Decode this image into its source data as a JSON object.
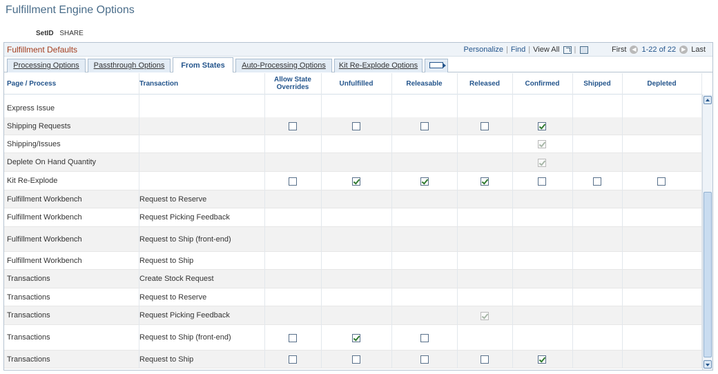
{
  "page": {
    "title": "Fulfillment Engine Options"
  },
  "setid": {
    "label": "SetID",
    "value": "SHARE"
  },
  "grid": {
    "title": "Fulfillment Defaults",
    "nav": {
      "personalize": "Personalize",
      "find": "Find",
      "view_all": "View All",
      "first": "First",
      "range": "1-22 of 22",
      "last": "Last",
      "icons": [
        "zoom-icon",
        "download-icon",
        "prev-icon",
        "next-icon"
      ]
    }
  },
  "tabs": [
    {
      "label": "Processing Options",
      "active": false
    },
    {
      "label": "Passthrough Options",
      "active": false
    },
    {
      "label": "From States",
      "active": true
    },
    {
      "label": "Auto-Processing Options",
      "active": false
    },
    {
      "label": "Kit Re-Explode Options",
      "active": false
    },
    {
      "label": "",
      "icon": "show-all-columns-icon"
    }
  ],
  "columns": {
    "page_process": "Page / Process",
    "transaction": "Transaction",
    "allow": "Allow State Overrides",
    "unfulfilled": "Unfulfilled",
    "releasable": "Releasable",
    "released": "Released",
    "confirmed": "Confirmed",
    "shipped": "Shipped",
    "depleted": "Depleted"
  },
  "rows": [
    {
      "page": "Express Issue",
      "transaction": ""
    },
    {
      "page": "Shipping Requests",
      "transaction": ""
    },
    {
      "page": "Shipping/Issues",
      "transaction": ""
    },
    {
      "page": "Deplete On Hand Quantity",
      "transaction": ""
    },
    {
      "page": "Kit Re-Explode",
      "transaction": ""
    },
    {
      "page": "Fulfillment Workbench",
      "transaction": "Request to Reserve"
    },
    {
      "page": "Fulfillment Workbench",
      "transaction": "Request Picking Feedback"
    },
    {
      "page": "Fulfillment Workbench",
      "transaction": "Request to Ship (front-end)"
    },
    {
      "page": "Fulfillment Workbench",
      "transaction": "Request to Ship"
    },
    {
      "page": "Transactions",
      "transaction": "Create Stock Request"
    },
    {
      "page": "Transactions",
      "transaction": "Request to Reserve"
    },
    {
      "page": "Transactions",
      "transaction": "Request Picking Feedback"
    },
    {
      "page": "Transactions",
      "transaction": "Request to Ship (front-end)"
    },
    {
      "page": "Transactions",
      "transaction": "Request to Ship"
    }
  ],
  "checkbox_states": {
    "_legend": "per row: column key -> on/off/disabled-on; missing key = no checkbox",
    "1": {
      "allow": "off",
      "unfulfilled": "off",
      "releasable": "off",
      "released": "off",
      "confirmed": "on"
    },
    "2": {
      "confirmed": "disabled-on"
    },
    "3": {
      "confirmed": "disabled-on"
    },
    "4": {
      "allow": "off",
      "unfulfilled": "on",
      "releasable": "on",
      "released": "on",
      "confirmed": "off",
      "shipped": "off",
      "depleted": "off"
    },
    "11": {
      "released": "disabled-on"
    },
    "12": {
      "allow": "off",
      "unfulfilled": "on",
      "releasable": "off"
    },
    "13": {
      "allow": "off",
      "unfulfilled": "off",
      "releasable": "off",
      "released": "off",
      "confirmed": "on"
    }
  }
}
